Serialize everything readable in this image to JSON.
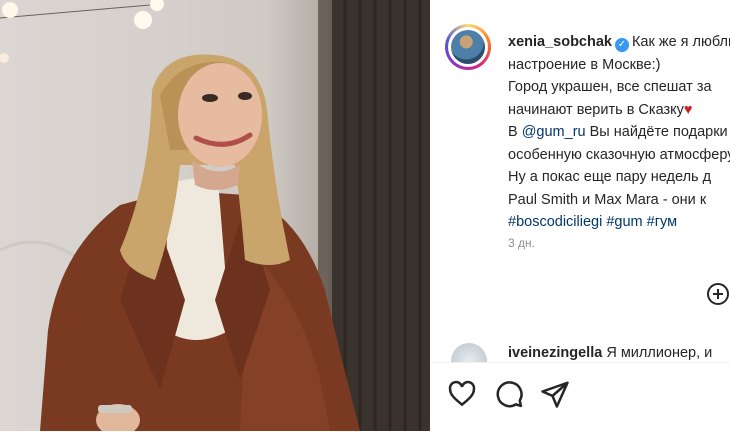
{
  "post": {
    "username": "xenia_sobchak",
    "caption_lines": [
      "Как же я люблю",
      "настроение в Москве:)",
      "Город украшен, все спешат за",
      "начинают верить в Сказку",
      "@gum_ru",
      " Вы найдёте подарки",
      "особенную сказочную атмосферу",
      "Ну а покас еще пару недель д",
      "Paul Smith и Max Mara - они к",
      "#boscodiciliegi #gum #гум"
    ],
    "caption_line5_prefix": "В ",
    "heart": "♥",
    "time": "3 дн."
  },
  "comment": {
    "username": "iveinezingella",
    "text": "Я миллионер, и"
  },
  "icons": {
    "verified": "verified-badge",
    "like": "heart-outline-icon",
    "comment": "speech-bubble-icon",
    "share": "paper-plane-icon",
    "emoji": "plus-circle-icon"
  },
  "colors": {
    "accent_link": "#00376b",
    "verified": "#3897f0",
    "heart": "#c8232c"
  }
}
